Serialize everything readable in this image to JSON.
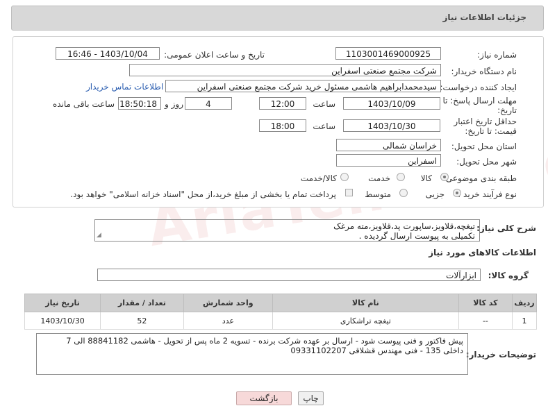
{
  "header": {
    "title": "جزئیات اطلاعات نیاز"
  },
  "form": {
    "need_number_label": "شماره نیاز:",
    "need_number": "1103001469000925",
    "announce_label": "تاریخ و ساعت اعلان عمومی:",
    "announce_value": "1403/10/04 - 16:46",
    "buyer_org_label": "نام دستگاه خریدار:",
    "buyer_org": "شرکت مجتمع صنعتی اسفراین",
    "requester_label": "ایجاد کننده درخواست:",
    "requester": "سیدمحمدابراهیم هاشمی مسئول خرید شرکت مجتمع صنعتی اسفراین",
    "contact_link": "اطلاعات تماس خریدار",
    "deadline_label": "مهلت ارسال پاسخ: تا تاریخ:",
    "deadline_date": "1403/10/09",
    "time_label": "ساعت",
    "deadline_time": "12:00",
    "days_value": "4",
    "days_label": "روز و",
    "remaining_time": "18:50:18",
    "remaining_label": "ساعت باقی مانده",
    "price_valid_label": "حداقل تاریخ اعتبار قیمت: تا تاریخ:",
    "price_valid_date": "1403/10/30",
    "price_valid_time": "18:00",
    "province_label": "استان محل تحویل:",
    "province": "خراسان شمالی",
    "city_label": "شهر محل تحویل:",
    "city": "اسفراین",
    "category_label": "طبقه بندی موضوعی:",
    "category_options": [
      "کالا",
      "خدمت",
      "کالا/خدمت"
    ],
    "category_selected": "کالا",
    "process_label": "نوع فرآیند خرید :",
    "process_options": [
      "جزیی",
      "متوسط"
    ],
    "process_selected": "جزیی",
    "treasury_note": "پرداخت تمام یا بخشی از مبلغ خرید،از محل \"اسناد خزانه اسلامی\" خواهد بود."
  },
  "description": {
    "label": "شرح کلی نیاز:",
    "text_line1": "تیغچه،قلاویز،ساپورت پد،قلاویز،مته مرغک",
    "text_line2": "تکمیلی به پیوست ارسال گردیده ."
  },
  "goods": {
    "section_title": "اطلاعات کالاهای مورد نیاز",
    "group_label": "گروه کالا:",
    "group_value": "ابزارآلات",
    "columns": [
      "ردیف",
      "کد کالا",
      "نام کالا",
      "واحد شمارش",
      "تعداد / مقدار",
      "تاریخ نیاز"
    ],
    "rows": [
      {
        "index": "1",
        "code": "--",
        "name": "تیغچه تراشکاری",
        "unit": "عدد",
        "qty": "52",
        "date": "1403/10/30"
      }
    ]
  },
  "buyer_notes": {
    "label": "توضیحات خریدار:",
    "line1": "پیش فاکتور و فنی پیوست شود - ارسال بر عهده شرکت برنده - تسویه 2 ماه پس از تحویل - هاشمی 88841182 الی 7",
    "line2": "داخلی 135 - فنی مهندس قشلاقی 09331102207"
  },
  "buttons": {
    "print": "چاپ",
    "back": "بازگشت"
  },
  "colors": {
    "header_bg": "#d8d8d8",
    "table_header_bg": "#d0d0d0",
    "link": "#2a5db0",
    "back_btn_bg": "#f7d9d9"
  }
}
